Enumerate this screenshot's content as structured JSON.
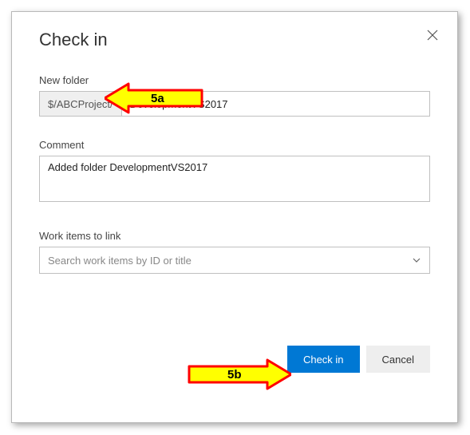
{
  "dialog": {
    "title": "Check in",
    "close_label": "Close"
  },
  "folder": {
    "label": "New folder",
    "prefix": "$/ABCProject/",
    "value": "DevelopmentVS2017"
  },
  "comment": {
    "label": "Comment",
    "value": "Added folder DevelopmentVS2017"
  },
  "workitems": {
    "label": "Work items to link",
    "placeholder": "Search work items by ID or title"
  },
  "buttons": {
    "primary": "Check in",
    "secondary": "Cancel"
  },
  "annotations": {
    "a": "5a",
    "b": "5b"
  },
  "colors": {
    "primary": "#0078d4",
    "annotation_fill": "#ffff00",
    "annotation_stroke": "#ff0000"
  }
}
